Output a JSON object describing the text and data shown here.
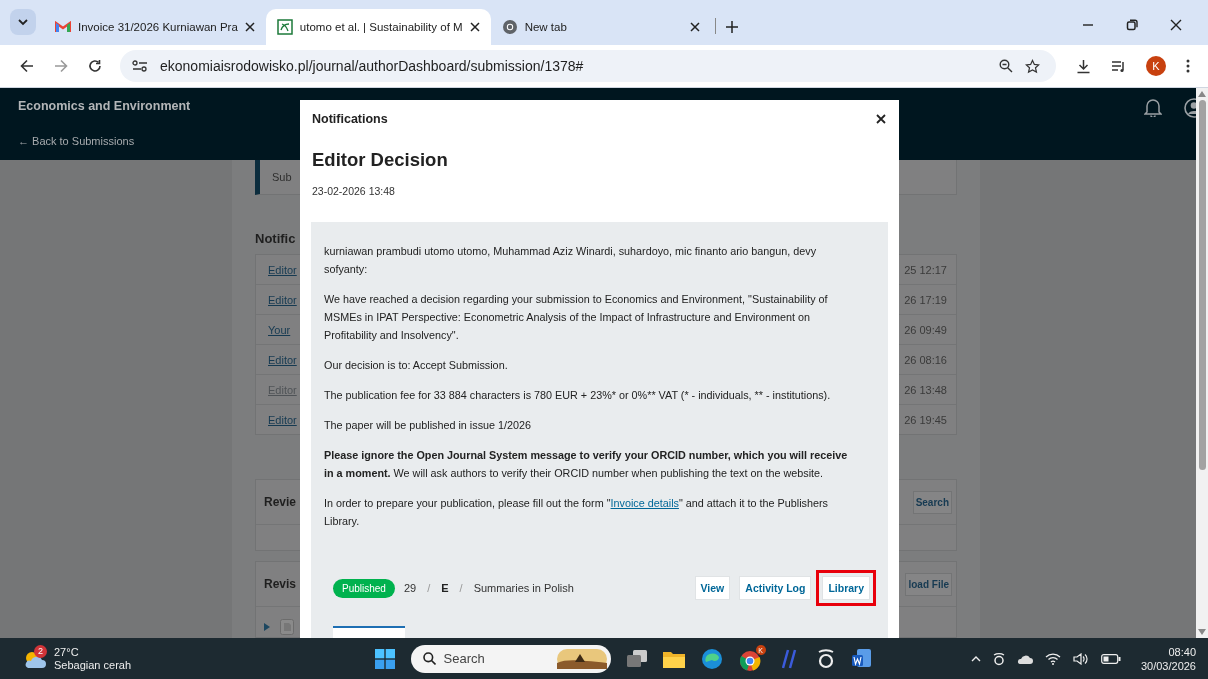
{
  "browser": {
    "tabs": [
      {
        "title": "Invoice 31/2026 Kurniawan Pra",
        "kind": "mail",
        "selected": false
      },
      {
        "title": "utomo et al. | Sustainability of M",
        "kind": "journal",
        "selected": true
      },
      {
        "title": "New tab",
        "kind": "chrome",
        "selected": false
      }
    ],
    "url": "ekonomiaisrodowisko.pl/journal/authorDashboard/submission/1378#",
    "profile": "K"
  },
  "header": {
    "journal": "Economics and Environment",
    "back": "← Back to Submissions"
  },
  "background": {
    "submission_tab": "Sub",
    "notifications_heading": "Notific",
    "notification_rows": [
      {
        "link": "Editor",
        "date": "25 12:17",
        "read": false
      },
      {
        "link": "Editor",
        "date": "26 17:19",
        "read": false
      },
      {
        "link": "Your",
        "date": "26 09:49",
        "read": false
      },
      {
        "link": "Editor",
        "date": "26 08:16",
        "read": false
      },
      {
        "link": "Editor",
        "date": "26 13:48",
        "read": true
      },
      {
        "link": "Editor",
        "date": "26 19:45",
        "read": false
      }
    ],
    "review_heading": "Revie",
    "review_button": "Search",
    "revision_heading": "Revis",
    "revision_button": "load File"
  },
  "modal": {
    "header": "Notifications",
    "title": "Editor Decision",
    "date": "23-02-2026 13:48",
    "paragraphs": [
      {
        "kind": "text",
        "text": "kurniawan prambudi utomo utomo, Muhammad Aziz Winardi, suhardoyo, mic finanto ario bangun, devy sofyanty:"
      },
      {
        "kind": "text",
        "text": "We have reached a decision regarding your submission to Economics and Environment, \"Sustainability of MSMEs in IPAT Perspective: Econometric Analysis of the Impact of Infrastructure and Environment on Profitability and Insolvency\"."
      },
      {
        "kind": "text",
        "text": "Our decision is to: Accept Submission."
      },
      {
        "kind": "text",
        "text": "The publication fee for 33 884 characters is 780 EUR + 23%* or 0%** VAT (* - individuals, ** - institutions)."
      },
      {
        "kind": "text",
        "text": "The paper will be published in issue 1/2026"
      },
      {
        "kind": "text",
        "text": "**Please ignore the Open Journal System message to verify your ORCID number, which you will receive in a moment.** We will ask authors to verify their ORCID number when publishing the text on the website."
      },
      {
        "kind": "link",
        "before": "In order to prepare your publication, please fill out the form \"",
        "link": "Invoice details",
        "after": "\" and attach it to the Publishers Library."
      }
    ],
    "footer": {
      "status": "Published",
      "crumbs": [
        {
          "text": "29",
          "kind": "plain"
        },
        {
          "text": "/",
          "kind": "sep"
        },
        {
          "text": "E",
          "kind": "bold"
        },
        {
          "text": "/",
          "kind": "sep"
        },
        {
          "text": "Summaries in Polish",
          "kind": "plain"
        }
      ],
      "buttons": [
        {
          "label": "View",
          "highlighted": false
        },
        {
          "label": "Activity Log",
          "highlighted": false
        },
        {
          "label": "Library",
          "highlighted": true
        }
      ]
    }
  },
  "taskbar": {
    "weather_badge": "2",
    "temperature": "27°C",
    "weather": "Sebagian cerah",
    "search_label": "Search",
    "chrome_badge": "K",
    "time": "08:40",
    "date": "30/03/2026"
  }
}
